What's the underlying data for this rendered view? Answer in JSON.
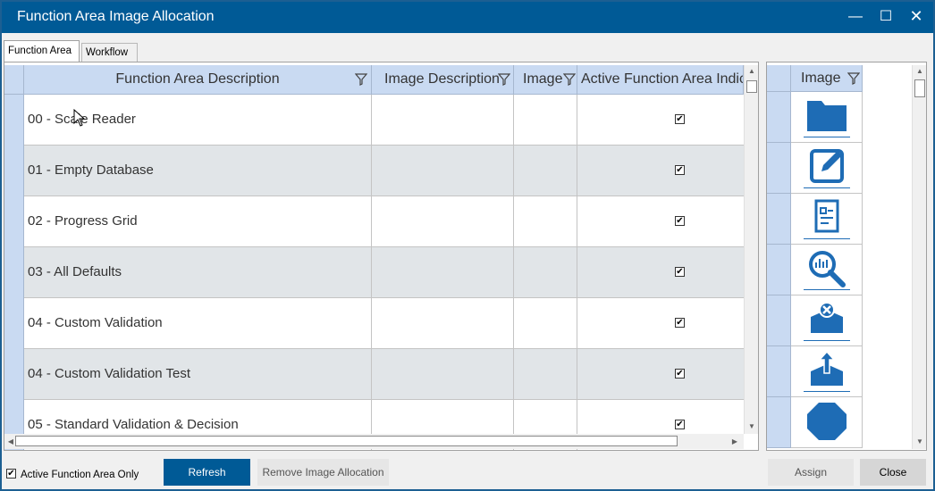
{
  "window": {
    "title": "Function Area Image Allocation",
    "minimize_glyph": "—",
    "maximize_glyph": "☐",
    "close_glyph": "✕"
  },
  "tabs": [
    {
      "label": "Function Area",
      "active": true
    },
    {
      "label": "Workflow",
      "active": false
    }
  ],
  "grid": {
    "columns": {
      "description": "Function Area Description",
      "image_description": "Image Description",
      "image": "Image",
      "active": "Active Function Area Indicator"
    },
    "rows": [
      {
        "description": "00 - Scale Reader",
        "active": true
      },
      {
        "description": "01 - Empty Database",
        "active": true
      },
      {
        "description": "02 - Progress Grid",
        "active": true
      },
      {
        "description": "03 - All Defaults",
        "active": true
      },
      {
        "description": "04 - Custom Validation",
        "active": true
      },
      {
        "description": "04 - Custom Validation Test",
        "active": true
      },
      {
        "description": "05 - Standard Validation & Decision",
        "active": true
      }
    ]
  },
  "image_list": {
    "header": "Image",
    "items": [
      "folder-icon",
      "edit-form-icon",
      "checklist-document-icon",
      "analytics-search-icon",
      "inbox-reject-icon",
      "inbox-upload-icon",
      "stop-octagon-icon"
    ]
  },
  "footer": {
    "active_only_label": "Active Function Area Only",
    "active_only_checked": true,
    "refresh_label": "Refresh",
    "remove_label": "Remove Image Allocation",
    "assign_label": "Assign",
    "close_label": "Close"
  },
  "colors": {
    "accent": "#005a96",
    "icon_blue": "#1e6cb5",
    "header_bg": "#c9daf2",
    "alt_row": "#e1e5e8"
  },
  "checkmark": "✔"
}
